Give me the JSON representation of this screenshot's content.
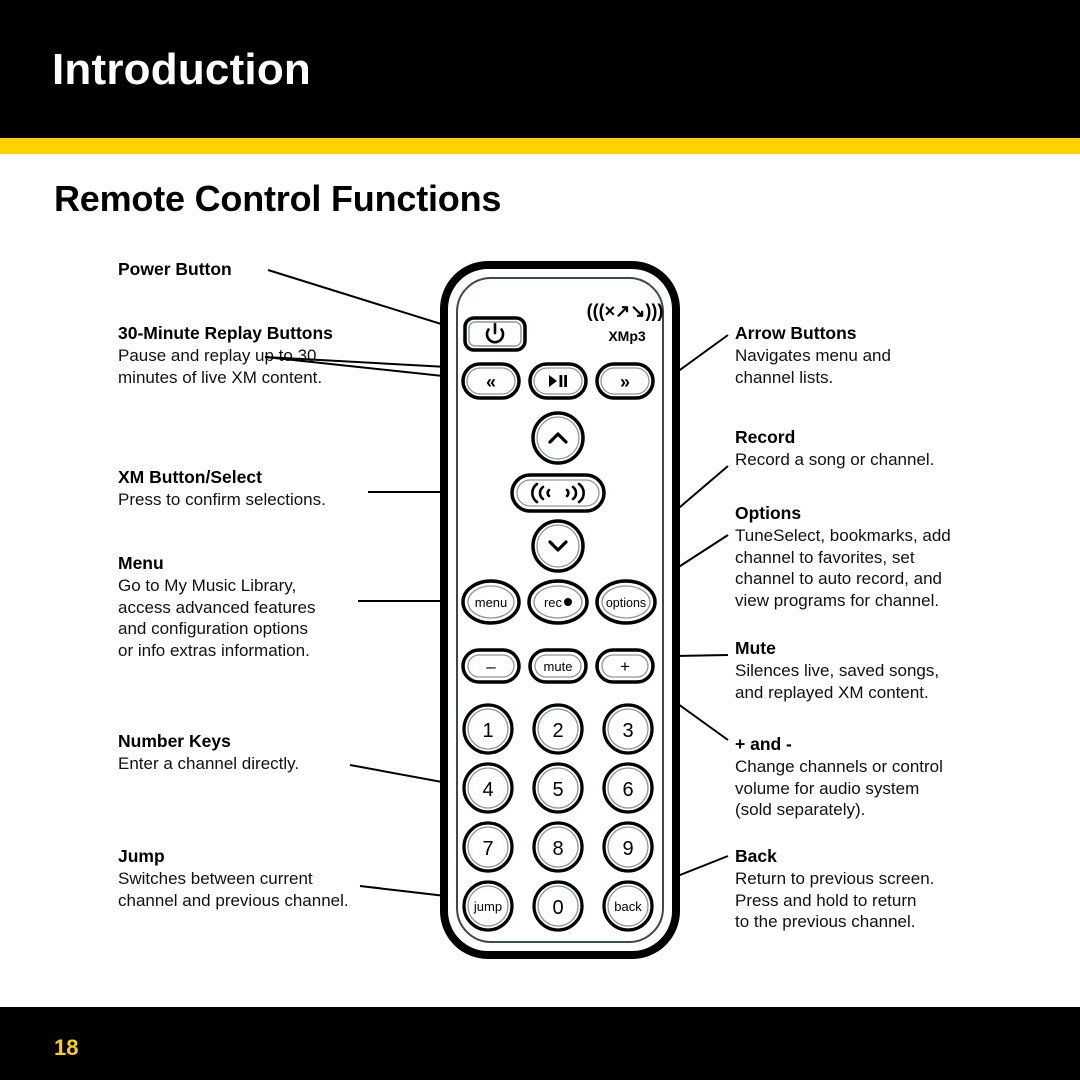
{
  "header": {
    "title": "Introduction",
    "stripe_color": "#FFD200",
    "background_color": "#000000"
  },
  "page_heading": "Remote Control Functions",
  "footer": {
    "page_number": "18",
    "page_number_color": "#FFD200",
    "background_color": "#000000"
  },
  "callouts_left": [
    {
      "title": "Power Button",
      "body": []
    },
    {
      "title": "30-Minute Replay Buttons",
      "body": [
        "Pause and replay up to 30",
        "minutes of live XM content."
      ]
    },
    {
      "title": "XM Button/Select",
      "body": [
        "Press to confirm selections."
      ]
    },
    {
      "title": "Menu",
      "body": [
        "Go to My Music Library,",
        "access advanced features",
        "and configuration options",
        "or info extras information."
      ]
    },
    {
      "title": "Number Keys",
      "body": [
        "Enter a channel directly."
      ]
    },
    {
      "title": "Jump",
      "body": [
        "Switches between current",
        "channel and previous channel."
      ]
    }
  ],
  "callouts_right": [
    {
      "title": "Arrow Buttons",
      "body": [
        "Navigates menu and",
        "channel lists."
      ]
    },
    {
      "title": "Record",
      "body": [
        "Record a song or channel."
      ]
    },
    {
      "title": "Options",
      "body": [
        "TuneSelect, bookmarks, add",
        "channel to favorites, set",
        "channel to auto record, and",
        "view programs for channel."
      ]
    },
    {
      "title": "Mute",
      "body": [
        "Silences live, saved songs,",
        "and replayed XM content."
      ]
    },
    {
      "title": "+ and -",
      "body": [
        "Change channels or control",
        "volume for audio system",
        "(sold separately)."
      ]
    },
    {
      "title": "Back",
      "body": [
        "Return to previous screen.",
        "Press and hold to return",
        "to the previous channel."
      ]
    }
  ],
  "remote": {
    "brand_logo": "(((XM)))",
    "model_label": "XMp3",
    "buttons": {
      "power": "power-icon",
      "replay_back": "«",
      "play_pause": "▶❙❙",
      "replay_forward": "»",
      "up_arrow": "˄",
      "xm_select": "signal-icon",
      "down_arrow": "˅",
      "menu": "menu",
      "record": "rec",
      "options": "options",
      "minus": "–",
      "mute": "mute",
      "plus": "+",
      "keypad": [
        "1",
        "2",
        "3",
        "4",
        "5",
        "6",
        "7",
        "8",
        "9"
      ],
      "jump": "jump",
      "zero": "0",
      "back": "back"
    }
  }
}
